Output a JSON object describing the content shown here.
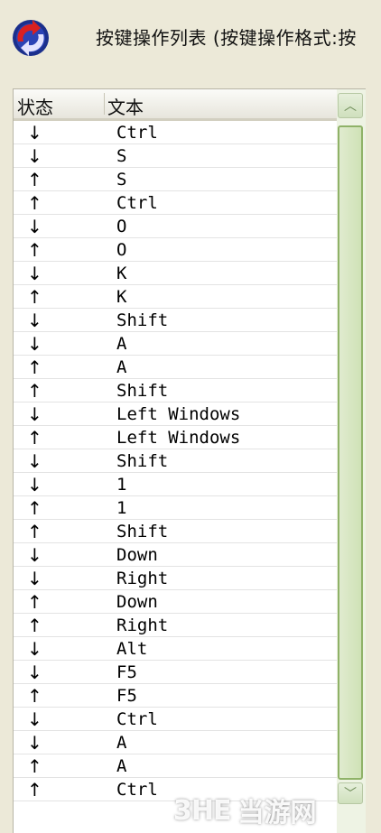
{
  "window": {
    "title": "按键操作列表 (按键操作格式:按"
  },
  "list": {
    "columns": [
      "状态",
      "文本"
    ],
    "rows": [
      {
        "state": "↓",
        "text": "Ctrl"
      },
      {
        "state": "↓",
        "text": "S"
      },
      {
        "state": "↑",
        "text": "S"
      },
      {
        "state": "↑",
        "text": "Ctrl"
      },
      {
        "state": "↓",
        "text": "O"
      },
      {
        "state": "↑",
        "text": "O"
      },
      {
        "state": "↓",
        "text": "K"
      },
      {
        "state": "↑",
        "text": "K"
      },
      {
        "state": "↓",
        "text": "Shift"
      },
      {
        "state": "↓",
        "text": "A"
      },
      {
        "state": "↑",
        "text": "A"
      },
      {
        "state": "↑",
        "text": "Shift"
      },
      {
        "state": "↓",
        "text": "Left Windows"
      },
      {
        "state": "↑",
        "text": "Left Windows"
      },
      {
        "state": "↓",
        "text": "Shift"
      },
      {
        "state": "↓",
        "text": "1"
      },
      {
        "state": "↑",
        "text": "1"
      },
      {
        "state": "↑",
        "text": "Shift"
      },
      {
        "state": "↓",
        "text": "Down"
      },
      {
        "state": "↓",
        "text": "Right"
      },
      {
        "state": "↑",
        "text": "Down"
      },
      {
        "state": "↑",
        "text": "Right"
      },
      {
        "state": "↓",
        "text": "Alt"
      },
      {
        "state": "↓",
        "text": "F5"
      },
      {
        "state": "↑",
        "text": "F5"
      },
      {
        "state": "↓",
        "text": "Ctrl"
      },
      {
        "state": "↓",
        "text": "A"
      },
      {
        "state": "↑",
        "text": "A"
      },
      {
        "state": "↑",
        "text": "Ctrl"
      }
    ]
  },
  "watermark": {
    "logo": "3HE",
    "text": "当游网"
  }
}
